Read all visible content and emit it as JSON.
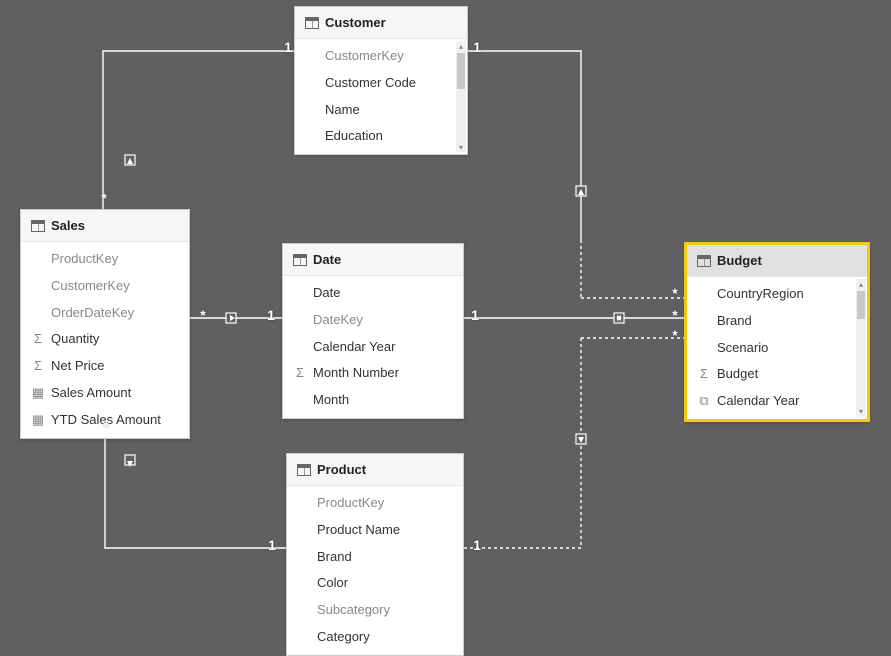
{
  "tables": {
    "customer": {
      "title": "Customer",
      "fields": [
        {
          "label": "CustomerKey",
          "dim": true,
          "icon": ""
        },
        {
          "label": "Customer Code",
          "dim": false,
          "icon": ""
        },
        {
          "label": "Name",
          "dim": false,
          "icon": ""
        },
        {
          "label": "Education",
          "dim": false,
          "icon": ""
        }
      ]
    },
    "sales": {
      "title": "Sales",
      "fields": [
        {
          "label": "ProductKey",
          "dim": true,
          "icon": ""
        },
        {
          "label": "CustomerKey",
          "dim": true,
          "icon": ""
        },
        {
          "label": "OrderDateKey",
          "dim": true,
          "icon": ""
        },
        {
          "label": "Quantity",
          "dim": false,
          "icon": "sigma"
        },
        {
          "label": "Net Price",
          "dim": false,
          "icon": "sigma"
        },
        {
          "label": "Sales Amount",
          "dim": false,
          "icon": "calc"
        },
        {
          "label": "YTD Sales Amount",
          "dim": false,
          "icon": "calc"
        }
      ]
    },
    "date": {
      "title": "Date",
      "fields": [
        {
          "label": "Date",
          "dim": false,
          "icon": ""
        },
        {
          "label": "DateKey",
          "dim": true,
          "icon": ""
        },
        {
          "label": "Calendar Year",
          "dim": false,
          "icon": ""
        },
        {
          "label": "Month Number",
          "dim": false,
          "icon": "sigma"
        },
        {
          "label": "Month",
          "dim": false,
          "icon": ""
        }
      ]
    },
    "budget": {
      "title": "Budget",
      "fields": [
        {
          "label": "CountryRegion",
          "dim": false,
          "icon": ""
        },
        {
          "label": "Brand",
          "dim": false,
          "icon": ""
        },
        {
          "label": "Scenario",
          "dim": false,
          "icon": ""
        },
        {
          "label": "Budget",
          "dim": false,
          "icon": "sigma"
        },
        {
          "label": "Calendar Year",
          "dim": false,
          "icon": "calcgrp"
        }
      ]
    },
    "product": {
      "title": "Product",
      "fields": [
        {
          "label": "ProductKey",
          "dim": true,
          "icon": ""
        },
        {
          "label": "Product Name",
          "dim": false,
          "icon": ""
        },
        {
          "label": "Brand",
          "dim": false,
          "icon": ""
        },
        {
          "label": "Color",
          "dim": false,
          "icon": ""
        },
        {
          "label": "Subcategory",
          "dim": true,
          "icon": ""
        },
        {
          "label": "Category",
          "dim": false,
          "icon": ""
        }
      ]
    }
  },
  "cardinality": {
    "one": "1",
    "many": "*"
  },
  "icons": {
    "sigma": "Σ",
    "calc": "▦",
    "calcgrp": "⧉"
  },
  "relationships": [
    {
      "from": "Customer",
      "fromCard": "1",
      "to": "Sales",
      "toCard": "*",
      "direction": "single"
    },
    {
      "from": "Customer",
      "fromCard": "1",
      "to": "Budget",
      "toCard": "*",
      "direction": "single"
    },
    {
      "from": "Date",
      "fromCard": "1",
      "to": "Sales",
      "toCard": "*",
      "direction": "single"
    },
    {
      "from": "Date",
      "fromCard": "1",
      "to": "Budget",
      "toCard": "*",
      "direction": "both"
    },
    {
      "from": "Product",
      "fromCard": "1",
      "to": "Sales",
      "toCard": "*",
      "direction": "single"
    },
    {
      "from": "Product",
      "fromCard": "1",
      "to": "Budget",
      "toCard": "*",
      "direction": "single"
    }
  ]
}
